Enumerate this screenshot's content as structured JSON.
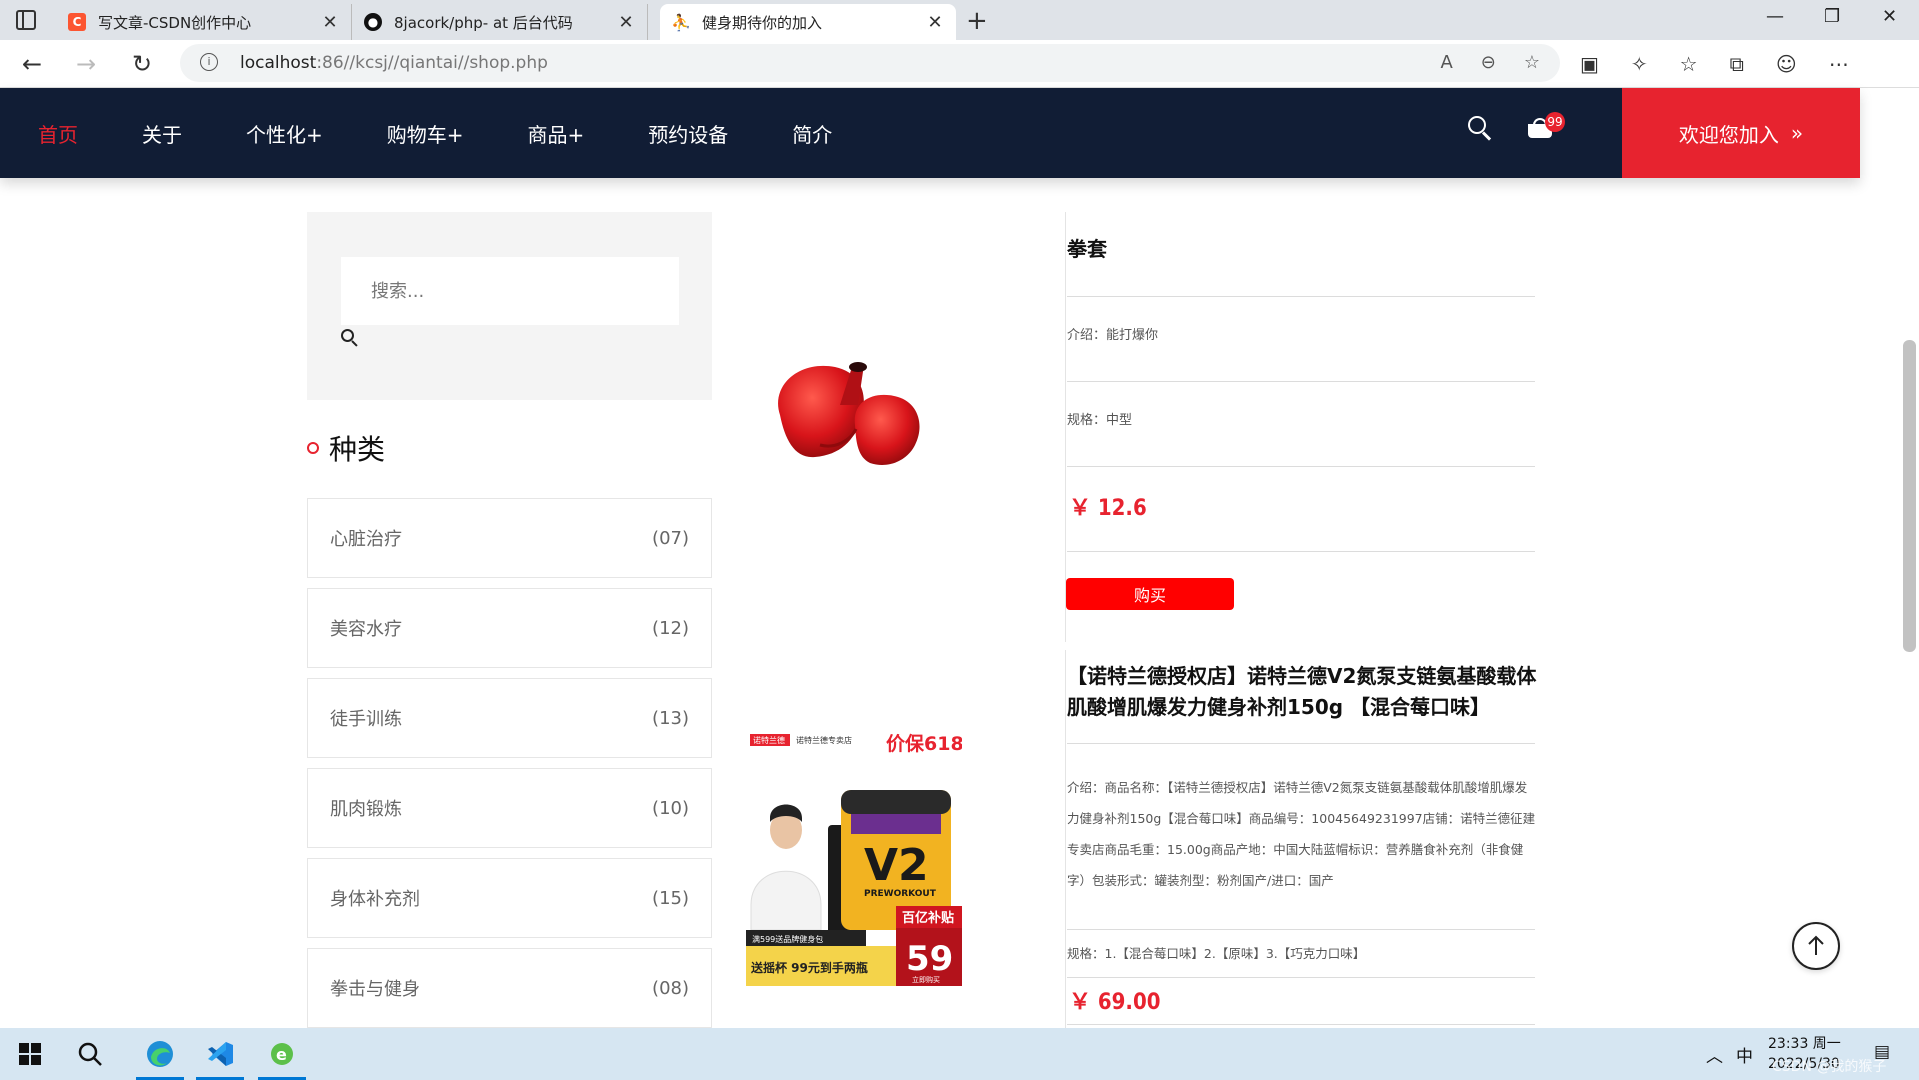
{
  "browser": {
    "tabs": [
      {
        "title": "写文章-CSDN创作中心",
        "favicon": "csdn-icon",
        "color": "#fc5531"
      },
      {
        "title": "8jacork/php- at 后台代码",
        "favicon": "github-icon",
        "color": "#111111"
      },
      {
        "title": "健身期待你的加入",
        "favicon": "runner-icon",
        "color": "#e7232f"
      }
    ],
    "url_host": "localhost",
    "url_rest": ":86//kcsj//qiantai//shop.php"
  },
  "nav": {
    "items": [
      "首页",
      "关于",
      "个性化+",
      "购物车+",
      "商品+",
      "预约设备",
      "简介"
    ],
    "active_index": 0,
    "cart_count": "99",
    "join_label": "欢迎您加入",
    "accent_color": "#e7232f",
    "bg_color": "#111d35"
  },
  "sidebar": {
    "search_placeholder": "搜索...",
    "categories_title": "种类",
    "categories": [
      {
        "name": "心脏治疗",
        "count": "(07)"
      },
      {
        "name": "美容水疗",
        "count": "(12)"
      },
      {
        "name": "徒手训练",
        "count": "(13)"
      },
      {
        "name": "肌肉锻炼",
        "count": "(10)"
      },
      {
        "name": "身体补充剂",
        "count": "(15)"
      },
      {
        "name": "拳击与健身",
        "count": "(08)"
      }
    ]
  },
  "products": [
    {
      "name": "拳套",
      "intro": "介绍：能打爆你",
      "spec": "规格：中型",
      "price": "￥ 12.6",
      "buy_label": "购买"
    },
    {
      "name": "【诺特兰德授权店】诺特兰德V2氮泵支链氨基酸载体肌酸增肌爆发力健身补剂150g 【混合莓口味】",
      "intro": "介绍：商品名称：【诺特兰德授权店】诺特兰德V2氮泵支链氨基酸载体肌酸增肌爆发力健身补剂150g【混合莓口味】商品编号：10045649231997店铺：诺特兰德征建专卖店商品毛重：15.00g商品产地：中国大陆蓝帽标识：营养膳食补充剂（非食健字）包装形式：罐装剂型：粉剂国产/进口：国产",
      "spec": "规格：1.【混合莓口味】2.【原味】3.【巧克力口味】",
      "price": "￥ 69.00",
      "image_text": {
        "brand": "诺特兰德",
        "store": "诺特兰德专卖店",
        "promo": "价保618",
        "product_label": "V2",
        "product_sub": "PREWORKOUT",
        "subsidy": "百亿补贴",
        "gift": "满599送品牌健身包",
        "cup": "送摇杯 99元到手两瓶",
        "sale_price": "59",
        "buy_now": "立即购买"
      }
    }
  ],
  "taskbar": {
    "ime": "中",
    "time": "23:33 周一",
    "date": "2022/5/30",
    "watermark": "CSDN @我的猴子"
  }
}
